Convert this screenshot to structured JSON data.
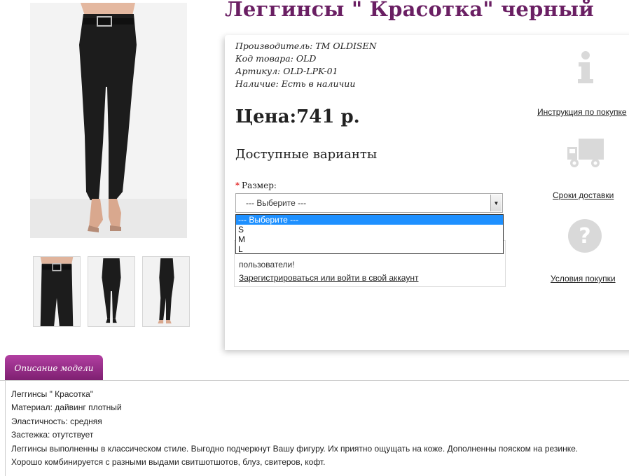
{
  "product": {
    "title": "Леггинсы \" Красотка\" черный",
    "specs": [
      {
        "label": "Производитель:",
        "value": "TM OLDISEN"
      },
      {
        "label": "Код товара:",
        "value": "OLD"
      },
      {
        "label": "Артикул:",
        "value": "OLD-LPK-01"
      },
      {
        "label": "Наличие:",
        "value": "Есть в наличии"
      }
    ],
    "price": "Цена:741 р.",
    "variants_title": "Доступные варианты",
    "size": {
      "required_mark": "*",
      "label": "Размер:",
      "selected": "--- Выберите ---",
      "options": [
        "--- Выберите ---",
        "S",
        "M",
        "L"
      ]
    },
    "notice": {
      "text": "пользователи!",
      "link": "Зарегистрироваться или войти в свой аккаунт"
    }
  },
  "side_links": {
    "instructions": "Инструкция по покупке",
    "delivery": "Сроки доставки",
    "terms": "Условия покупки"
  },
  "description": {
    "tab_label": "Описание модели",
    "lines": [
      "Леггинсы \" Красотка\"",
      "Материал: дайвинг плотный",
      "Эластичность: средняя",
      "Застежка: отутствует",
      "Леггинсы  выполненны в классическом стиле. Выгодно подчеркнут Вашу фигуру. Их приятно ощущать на коже. Дополненны пояском на резинке.",
      "Хорошо комбинируется с разными выдами свитшотшотов, блуз, свитеров, кофт."
    ]
  },
  "colors": {
    "title": "#6a1f63",
    "tab_top": "#b23fa2",
    "tab_bottom": "#7d1f70",
    "option_highlight": "#1e90ff",
    "icon_gray": "#d9d9d9"
  }
}
